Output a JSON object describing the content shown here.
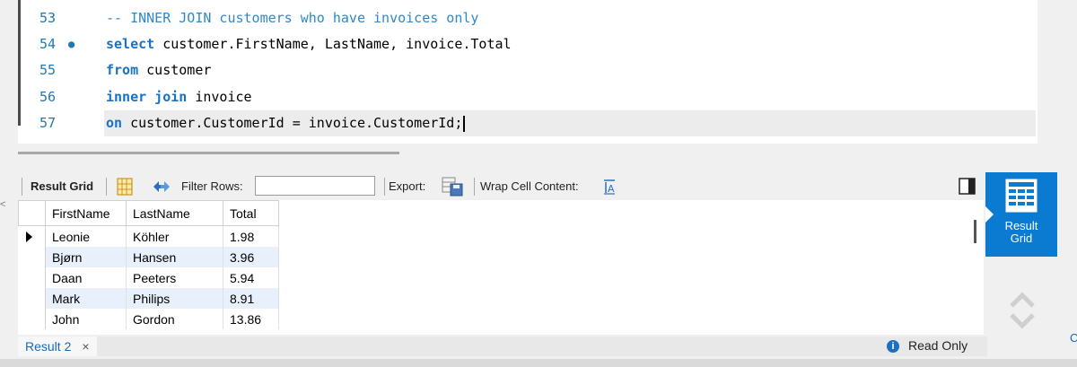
{
  "editor": {
    "lines": [
      {
        "num": "53",
        "comment": "-- INNER JOIN customers who have invoices only"
      },
      {
        "num": "54",
        "dot": "●",
        "kw": "select",
        "rest": " customer.FirstName, LastName, invoice.Total"
      },
      {
        "num": "55",
        "kw": "from",
        "rest": " customer"
      },
      {
        "num": "56",
        "kw": "inner join",
        "rest": " invoice"
      },
      {
        "num": "57",
        "kw": "on",
        "rest": " customer.CustomerId = invoice.CustomerId;"
      }
    ]
  },
  "toolbar": {
    "result_grid": "Result Grid",
    "filter_rows": "Filter Rows:",
    "filter_value": "",
    "export": "Export:",
    "wrap": "Wrap Cell Content:"
  },
  "grid": {
    "headers": [
      "FirstName",
      "LastName",
      "Total"
    ],
    "rows": [
      [
        "Leonie",
        "Köhler",
        "1.98"
      ],
      [
        "Bjørn",
        "Hansen",
        "3.96"
      ],
      [
        "Daan",
        "Peeters",
        "5.94"
      ],
      [
        "Mark",
        "Philips",
        "8.91"
      ],
      [
        "John",
        "Gordon",
        "13.86"
      ]
    ]
  },
  "side": {
    "label_line1": "Result",
    "label_line2": "Grid"
  },
  "bottom": {
    "tab": "Result 2",
    "close": "×",
    "status": "Read Only",
    "info": "i"
  },
  "edges": {
    "c": "C",
    "lt": "<"
  },
  "colors": {
    "accent": "#0a7bd0",
    "keyword": "#1a72c5",
    "line_number": "#1c7ab0"
  }
}
